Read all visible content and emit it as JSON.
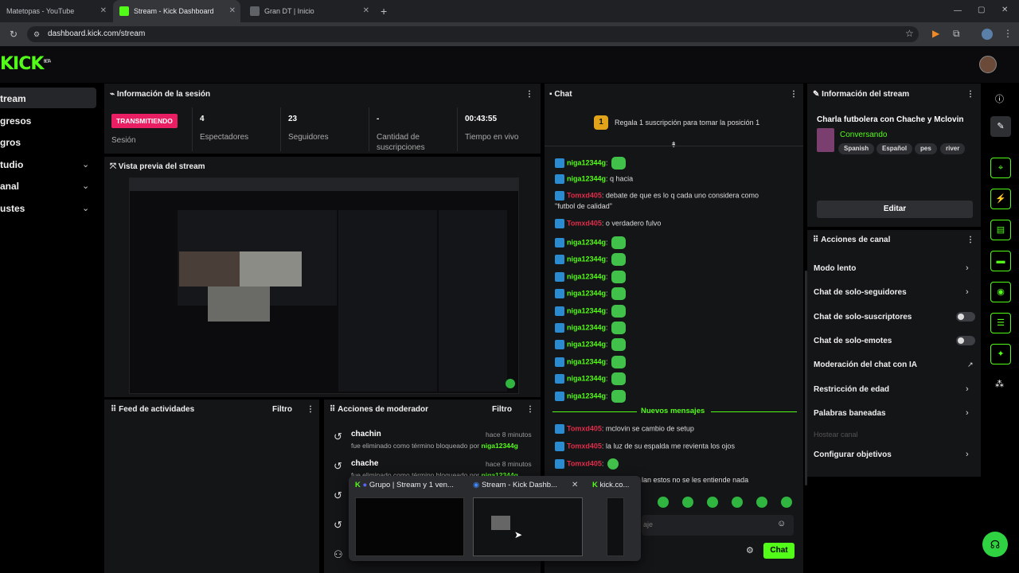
{
  "browser": {
    "tabs": [
      {
        "title": "Matetopas - YouTube"
      },
      {
        "title": "Stream - Kick Dashboard"
      },
      {
        "title": "Gran DT | Inicio"
      }
    ],
    "url": "dashboard.kick.com/stream"
  },
  "app": {
    "logo": "KICK",
    "logo_badge": "BETA"
  },
  "sidebar": {
    "items": [
      {
        "label": "tream"
      },
      {
        "label": "gresos"
      },
      {
        "label": "gros"
      },
      {
        "label": "tudio"
      },
      {
        "label": "anal"
      },
      {
        "label": "ustes"
      }
    ]
  },
  "session": {
    "title": "Información de la sesión",
    "status_badge": "TRANSMITIENDO",
    "status_label": "Sesión",
    "stats": [
      {
        "value": "4",
        "label": "Espectadores"
      },
      {
        "value": "23",
        "label": "Seguidores"
      },
      {
        "value": "-",
        "label": "Cantidad de suscripciones"
      },
      {
        "value": "00:43:55",
        "label": "Tiempo en vivo"
      }
    ]
  },
  "preview": {
    "title": "Vista previa del stream"
  },
  "feed": {
    "title": "Feed de actividades",
    "filter": "Filtro"
  },
  "mod_actions": {
    "title": "Acciones de moderador",
    "filter": "Filtro",
    "items": [
      {
        "user": "chachin",
        "time": "hace 8 minutos",
        "desc": "fue eliminado como término bloqueado por",
        "by": "niga12344g"
      },
      {
        "user": "chache",
        "time": "hace 8 minutos",
        "desc": "fue eliminado como término bloqueado por",
        "by": "niga12344g"
      }
    ]
  },
  "chat": {
    "title": "Chat",
    "pinned": "Regala 1 suscripción para tomar la posición 1",
    "messages": [
      {
        "user": "niga12344g",
        "color": "green",
        "text": "",
        "emote": true
      },
      {
        "user": "niga12344g",
        "color": "green",
        "text": "q hacia",
        "emote": false
      },
      {
        "user": "Tomxd405",
        "color": "red",
        "text": "debate de que es lo q cada uno considera como",
        "emote": false
      },
      {
        "user": "",
        "color": "",
        "text": "\"futbol de calidad\"",
        "emote": false
      },
      {
        "user": "Tomxd405",
        "color": "red",
        "text": "o verdadero fulvo",
        "emote": false
      },
      {
        "user": "niga12344g",
        "color": "green",
        "text": "",
        "emote": true
      },
      {
        "user": "niga12344g",
        "color": "green",
        "text": "",
        "emote": true
      },
      {
        "user": "niga12344g",
        "color": "green",
        "text": "",
        "emote": true
      },
      {
        "user": "niga12344g",
        "color": "green",
        "text": "",
        "emote": true
      },
      {
        "user": "niga12344g",
        "color": "green",
        "text": "",
        "emote": true
      },
      {
        "user": "niga12344g",
        "color": "green",
        "text": "",
        "emote": true
      },
      {
        "user": "niga12344g",
        "color": "green",
        "text": "",
        "emote": true
      },
      {
        "user": "niga12344g",
        "color": "green",
        "text": "",
        "emote": true
      },
      {
        "user": "niga12344g",
        "color": "green",
        "text": "",
        "emote": true
      },
      {
        "user": "niga12344g",
        "color": "green",
        "text": "",
        "emote": true
      }
    ],
    "new_messages_label": "Nuevos mensajes",
    "new_messages": [
      {
        "user": "Tomxd405",
        "text": "mclovin se cambio de setup"
      },
      {
        "user": "Tomxd405",
        "text": "la luz de su espalda me revienta los ojos"
      },
      {
        "user": "Tomxd405",
        "text": ""
      }
    ],
    "partial_line": "lan estos no se les entiende nada",
    "input_placeholder": "aje",
    "send_label": "Chat"
  },
  "stream_info": {
    "title": "Información del stream",
    "stream_title": "Charla futbolera con Chache y Mclovin",
    "category": "Conversando",
    "tags": [
      "Spanish",
      "Español",
      "pes",
      "river"
    ],
    "edit_label": "Editar"
  },
  "channel_actions": {
    "title": "Acciones de canal",
    "items": [
      {
        "label": "Modo lento",
        "control": "chevron"
      },
      {
        "label": "Chat de solo-seguidores",
        "control": "chevron"
      },
      {
        "label": "Chat de solo-suscriptores",
        "control": "toggle"
      },
      {
        "label": "Chat de solo-emotes",
        "control": "toggle"
      },
      {
        "label": "Moderación del chat con IA",
        "control": "external"
      },
      {
        "label": "Restricción de edad",
        "control": "chevron"
      },
      {
        "label": "Palabras baneadas",
        "control": "chevron"
      },
      {
        "label": "Hostear canal",
        "control": "disabled"
      },
      {
        "label": "Configurar objetivos",
        "control": "chevron"
      }
    ]
  },
  "tab_switcher": {
    "items": [
      {
        "title": "Grupo | Stream y 1 ven..."
      },
      {
        "title": "Stream - Kick Dashb..."
      },
      {
        "title": "kick.co..."
      }
    ]
  },
  "colors": {
    "accent": "#53fc18",
    "danger": "#e91e63",
    "panel": "#141517",
    "background": "#000000"
  }
}
